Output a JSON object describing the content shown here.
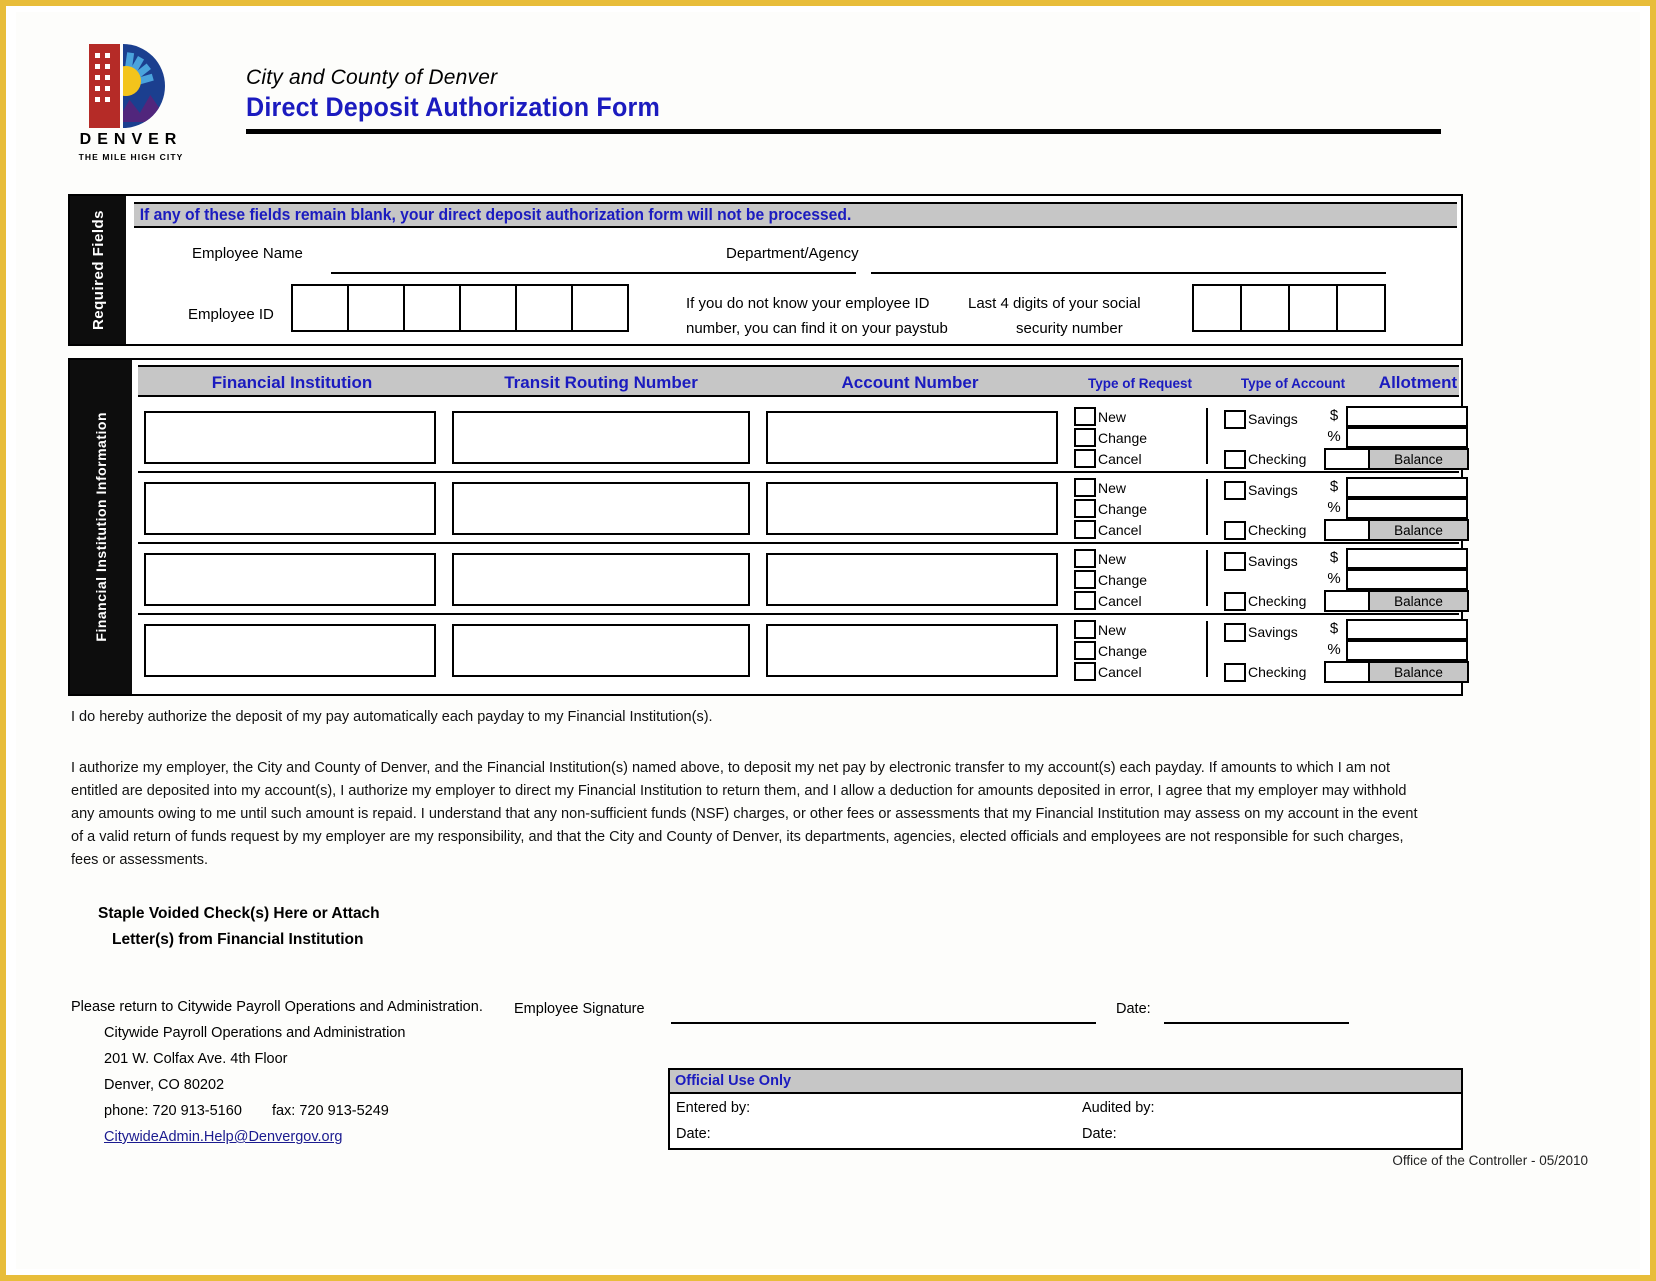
{
  "header": {
    "logo": {
      "wordmark": "DENVER",
      "tagline": "THE MILE HIGH CITY"
    },
    "subtitle": "City and County of Denver",
    "title": "Direct Deposit Authorization Form"
  },
  "required_section": {
    "tab_label": "Required Fields",
    "warning": "If any of these fields remain blank, your direct deposit authorization form will not be processed.",
    "employee_name_label": "Employee Name",
    "department_label": "Department/Agency",
    "employee_id_label": "Employee ID",
    "employee_id_hint_line1": "If you do not know your employee ID",
    "employee_id_hint_line2": "number, you can find it on your paystub",
    "ssn_label_line1": "Last 4 digits of your social",
    "ssn_label_line2": "security number",
    "employee_id_boxes": 6,
    "ssn_boxes": 4
  },
  "financial_section": {
    "tab_label": "Financial Institution Information",
    "columns": [
      "Financial Institution",
      "Transit Routing Number",
      "Account Number",
      "Type of Request",
      "Type of Account",
      "Allotment"
    ],
    "request_options": [
      "New",
      "Change",
      "Cancel"
    ],
    "account_options": [
      "Savings",
      "Checking"
    ],
    "allotment_symbols": [
      "$",
      "%"
    ],
    "balance_label": "Balance",
    "row_count": 4
  },
  "authorization": {
    "line1": "I do hereby authorize the deposit of my pay automatically each payday to my Financial Institution(s).",
    "paragraph": "I authorize my employer, the City and County of Denver, and the Financial Institution(s) named above, to deposit my net pay by electronic transfer to my account(s) each payday. If amounts to which I am not entitled are deposited into my account(s), I authorize my employer to direct my Financial Institution to return them, and I allow a deduction for amounts deposited in error, I agree that my employer may withhold any amounts owing to me until such amount is repaid. I understand that any non-sufficient funds (NSF) charges, or other fees or assessments that my Financial Institution may assess on my account in the event of a valid return of funds request by my employer are my responsibility, and that the City and County of Denver, its departments, agencies, elected officials and employees are not responsible for such charges, fees or assessments."
  },
  "staple": {
    "line1": "Staple Voided Check(s) Here or Attach",
    "line2": "Letter(s) from Financial Institution"
  },
  "signature": {
    "employee_signature_label": "Employee Signature",
    "date_label": "Date:"
  },
  "return_to": {
    "intro": "Please return to Citywide Payroll Operations and Administration.",
    "org": "Citywide Payroll Operations and Administration",
    "street": "201 W. Colfax Ave. 4th Floor",
    "city_state_zip": "Denver, CO 80202",
    "phone": "phone: 720 913-5160",
    "fax": "fax: 720 913-5249",
    "email": "CitywideAdmin.Help@Denvergov.org"
  },
  "official_use": {
    "title": "Official Use Only",
    "entered_by": "Entered by:",
    "audited_by": "Audited by:",
    "date_left": "Date:",
    "date_right": "Date:"
  },
  "footer": {
    "controller": "Office of the Controller - 05/2010"
  },
  "colors": {
    "accent_blue": "#1b1bbf",
    "header_gray": "#c6c6c6",
    "tab_black": "#0d0d0d",
    "page_border": "#e8bd3a",
    "logo_red": "#b52b27",
    "logo_blue": "#1b3f8f",
    "logo_sun": "#f3c41b",
    "logo_mountain": "#51267c"
  }
}
